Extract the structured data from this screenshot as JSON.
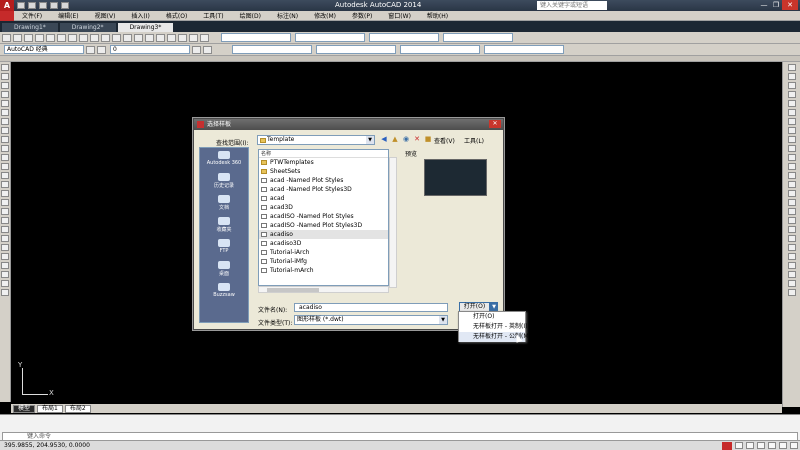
{
  "window": {
    "app_title": "Autodesk AutoCAD 2014",
    "search_placeholder": "键入关键字或短语",
    "quick_access_label": "AutoCAD 经典",
    "btn_min": "—",
    "btn_max": "❐",
    "btn_close": "✕"
  },
  "menubar": {
    "items": [
      "文件(F)",
      "编辑(E)",
      "视图(V)",
      "插入(I)",
      "格式(O)",
      "工具(T)",
      "绘图(D)",
      "标注(N)",
      "修改(M)",
      "参数(P)",
      "窗口(W)",
      "帮助(H)"
    ]
  },
  "drawing_tabs": [
    {
      "label": "Drawing1*"
    },
    {
      "label": "Drawing2*"
    },
    {
      "label": "Drawing3*"
    }
  ],
  "toolbar": {
    "workspace": "AutoCAD 经典",
    "layer_value": "0"
  },
  "layout_tabs": [
    "模型",
    "布局1",
    "布局2"
  ],
  "command": {
    "prompt": "键入命令"
  },
  "status": {
    "coords": "395.9855, 204.9530, 0.0000"
  },
  "dialog": {
    "title": "选择样板",
    "lookin_label": "查找范围(I):",
    "lookin_value": "Template",
    "menu_view": "查看(V)",
    "menu_tools": "工具(L)",
    "places": [
      "Autodesk 360",
      "历史记录",
      "文档",
      "收藏夹",
      "FTP",
      "桌面",
      "Buzzsaw"
    ],
    "list_header": "名称",
    "files": [
      {
        "name": "PTWTemplates",
        "type": "folder"
      },
      {
        "name": "SheetSets",
        "type": "folder"
      },
      {
        "name": "acad -Named Plot Styles",
        "type": "dwt"
      },
      {
        "name": "acad -Named Plot Styles3D",
        "type": "dwt"
      },
      {
        "name": "acad",
        "type": "dwt"
      },
      {
        "name": "acad3D",
        "type": "dwt"
      },
      {
        "name": "acadISO -Named Plot Styles",
        "type": "dwt"
      },
      {
        "name": "acadISO -Named Plot Styles3D",
        "type": "dwt"
      },
      {
        "name": "acadiso",
        "type": "dwt",
        "selected": true
      },
      {
        "name": "acadiso3D",
        "type": "dwt"
      },
      {
        "name": "Tutorial-iArch",
        "type": "dwt"
      },
      {
        "name": "Tutorial-iMfg",
        "type": "dwt"
      },
      {
        "name": "Tutorial-mArch",
        "type": "dwt"
      }
    ],
    "preview_label": "预览",
    "filename_label": "文件名(N):",
    "filename_value": "acadiso",
    "filetype_label": "文件类型(T):",
    "filetype_value": "图形样板 (*.dwt)",
    "open_label": "打开(O)",
    "open_menu": [
      "打开(O)",
      "无样板打开 - 英制(I)",
      "无样板打开 - 公制(M)"
    ]
  }
}
